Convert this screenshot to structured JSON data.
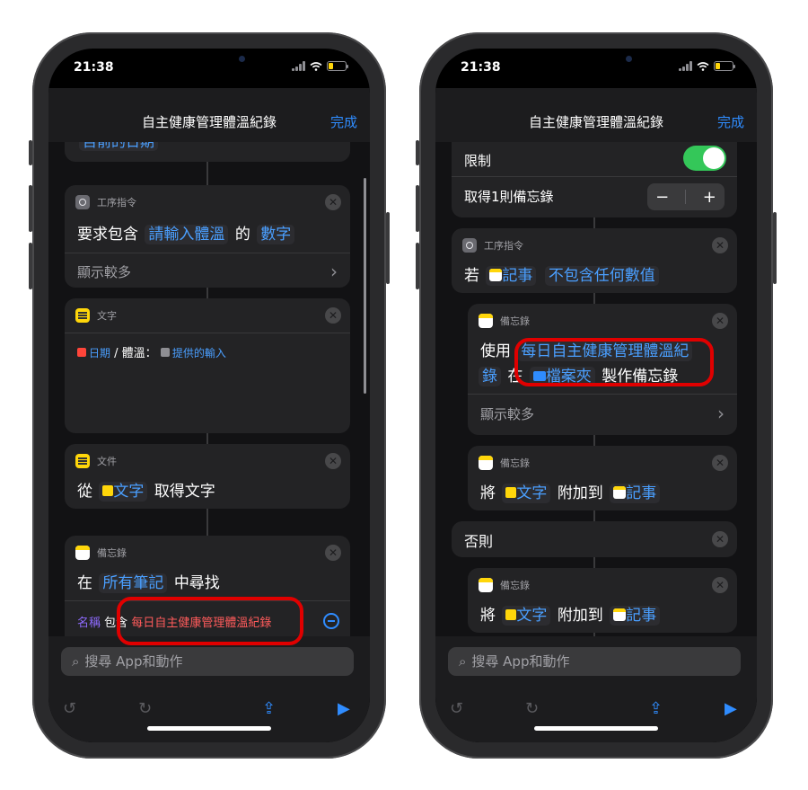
{
  "status": {
    "time": "21:38"
  },
  "nav": {
    "title": "自主健康管理體溫紀錄",
    "done": "完成"
  },
  "left": {
    "top_partial": "目前的日期",
    "card_ask": {
      "category": "工序指令",
      "prefix": "要求包含",
      "prompt": "請輸入體溫",
      "of": "的",
      "type": "數字",
      "more": "顯示較多"
    },
    "card_text": {
      "category": "文字",
      "date_token": "日期",
      "sep": "/ 體溫：",
      "input_token": "提供的輸入"
    },
    "card_doc": {
      "category": "文件",
      "from": "從",
      "text_token": "文字",
      "action": "取得文字"
    },
    "card_notes": {
      "category": "備忘錄",
      "in": "在",
      "all_notes": "所有筆記",
      "find": "中尋找",
      "name_label": "名稱",
      "contains": "包含",
      "value": "每日自主健康管理體溫紀錄"
    }
  },
  "right": {
    "limit_label": "限制",
    "get_label": "取得1則備忘錄",
    "stepper": {
      "minus": "−",
      "plus": "+"
    },
    "card_if": {
      "category": "工序指令",
      "if": "若",
      "notes_token": "記事",
      "condition": "不包含任何數值"
    },
    "card_create": {
      "category": "備忘錄",
      "use": "使用",
      "title_token": "每日自主健康管理體溫紀",
      "title_tail": "錄",
      "in": "在",
      "folder_token": "檔案夾",
      "action": "製作備忘錄",
      "more": "顯示較多"
    },
    "card_append1": {
      "category": "備忘錄",
      "will": "將",
      "text_token": "文字",
      "append_to": "附加到",
      "notes_token": "記事"
    },
    "otherwise": "否則",
    "card_append2": {
      "category": "備忘錄",
      "will": "將",
      "text_token": "文字",
      "append_to": "附加到",
      "notes_token": "記事"
    }
  },
  "toolbar": {
    "search_placeholder": "搜尋 App和動作"
  },
  "icons": {
    "undo": "undo-icon",
    "redo": "redo-icon",
    "share": "share-icon",
    "play": "play-icon",
    "search": "search-icon"
  },
  "colors": {
    "accent": "#2f8cff",
    "highlight": "#e00000",
    "toggle_on": "#34c759"
  }
}
